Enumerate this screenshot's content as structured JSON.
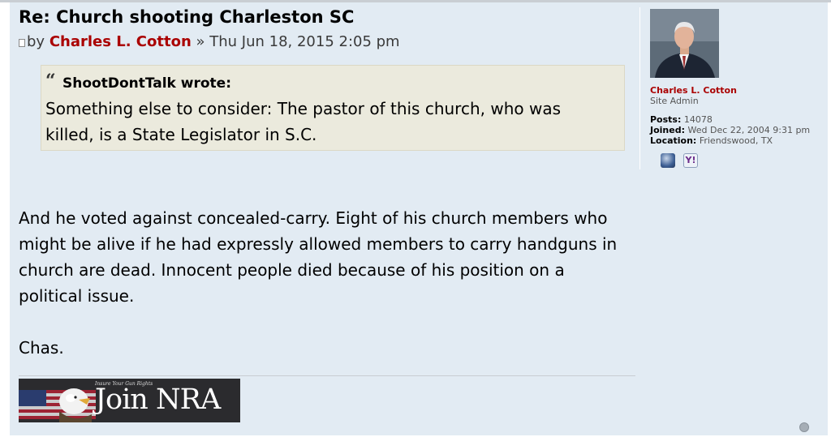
{
  "post": {
    "title": "Re: Church shooting Charleston SC",
    "byline": {
      "by_label": "by",
      "author": "Charles L. Cotton",
      "date": "» Thu Jun 18, 2015 2:05 pm"
    },
    "quote": {
      "author": "ShootDontTalk wrote:",
      "text": "Something else to consider: The pastor of this church, who was killed, is a State Legislator in S.C."
    },
    "body": [
      "And he voted against concealed-carry. Eight of his church members who might be alive if he had expressly allowed members to carry handguns in church are dead. Innocent people died because of his position on a political issue."
    ],
    "signature_name": "Chas.",
    "signature_banner": {
      "tagline": "Insure Your Gun Rights",
      "text": "Join NRA"
    }
  },
  "profile": {
    "name": "Charles L. Cotton",
    "rank": "Site Admin",
    "fields": [
      {
        "label": "Posts:",
        "value": "14078"
      },
      {
        "label": "Joined:",
        "value": "Wed Dec 22, 2004 9:31 pm"
      },
      {
        "label": "Location:",
        "value": "Friendswood, TX"
      }
    ],
    "contacts": [
      {
        "icon": "website-globe-icon"
      },
      {
        "icon": "yahoo-messenger-icon",
        "label": "Y!"
      }
    ]
  },
  "colors": {
    "post_bg": "#e2ebf3",
    "author": "#aa0000",
    "quote_bg": "#ebeadd"
  }
}
